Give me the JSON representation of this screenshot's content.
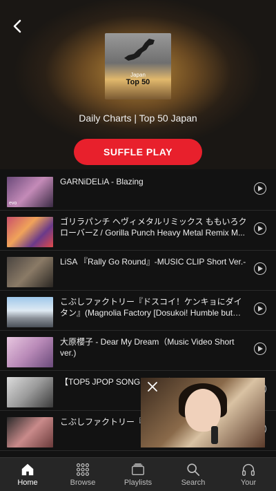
{
  "header": {
    "cover_line1": "Japan",
    "cover_line2": "Top 50",
    "subtitle": "Daily Charts | Top 50 Japan",
    "shuffle_label": "SUFFLE PLAY"
  },
  "tracks": [
    {
      "title": "GARNiDELiA - Blazing",
      "thumb_badge": "evo"
    },
    {
      "title": "ゴリラパンチ ヘヴィメタルリミックス ももいろクローバーZ / Gorilla Punch Heavy Metal Remix M..."
    },
    {
      "title": "LiSA 『Rally Go Round』-MUSIC CLIP Short Ver.-"
    },
    {
      "title": "こぶしファクトリー『ドスコイ！ケンキョにダイタン』(Magnolia Factory [Dosukoi! Humble but Bo..."
    },
    {
      "title": "大原櫻子 - Dear My Dream（Music Video Short ver.)"
    },
    {
      "title": "【TOP5 JPOP SONGS】ング2016カバー PPAP"
    },
    {
      "title": "こぶしファクトリー『唄』(Magnolia Factory"
    }
  ],
  "tabs": [
    {
      "label": "Home",
      "icon": "home-icon"
    },
    {
      "label": "Browse",
      "icon": "grid-icon"
    },
    {
      "label": "Playlists",
      "icon": "playlists-icon"
    },
    {
      "label": "Search",
      "icon": "search-icon"
    },
    {
      "label": "Your",
      "icon": "headphones-icon"
    }
  ],
  "colors": {
    "accent": "#e8202c",
    "background": "#121212",
    "tabbar": "#262626"
  }
}
